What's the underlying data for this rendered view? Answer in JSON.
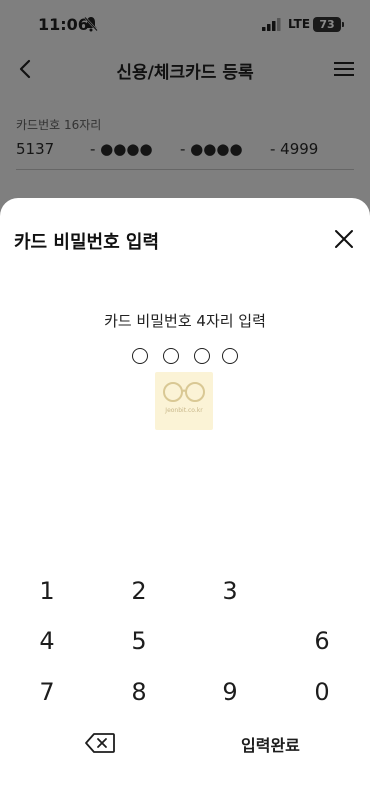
{
  "status_bar": {
    "time": "11:06",
    "network": "LTE",
    "battery": "73"
  },
  "header": {
    "title": "신용/체크카드 등록"
  },
  "card": {
    "label": "카드번호 16자리",
    "seg1": "5137",
    "seg2": "- ●●●●",
    "seg3": "- ●●●●",
    "seg4": "- 4999"
  },
  "sheet": {
    "title": "카드 비밀번호 입력",
    "prompt": "카드 비밀번호 4자리 입력",
    "pin_length": 4,
    "watermark": "Jeonbit.co.kr"
  },
  "keypad": {
    "keys": [
      "1",
      "2",
      "3",
      "4",
      "5",
      "6",
      "7",
      "8",
      "9",
      "0"
    ],
    "done_label": "입력완료"
  },
  "colors": {
    "dim": "#7f7f7f",
    "sheet": "#ffffff",
    "text": "#1d1d1d"
  }
}
